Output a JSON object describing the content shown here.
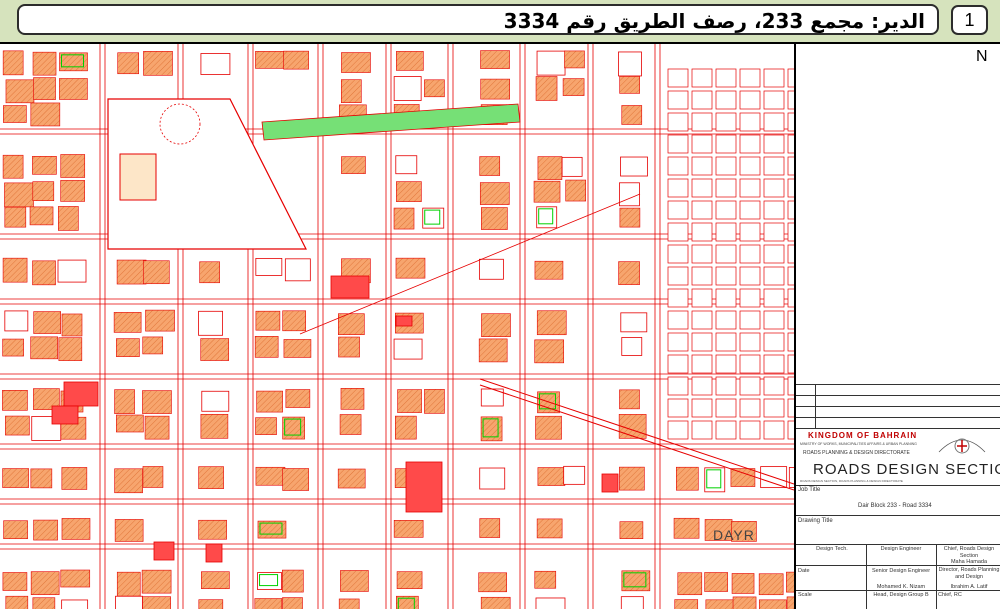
{
  "header": {
    "slide_number": "1",
    "title": "الدير: مجمع 233، رصف الطريق رقم 3334"
  },
  "map": {
    "place_label": "DAYR",
    "colors": {
      "parcel_fill": "#f7a56e",
      "road": "#e60000",
      "green": "#00d000",
      "highlight": "#ff4a4a",
      "park": "#76e076"
    }
  },
  "title_block": {
    "north_symbol": "N",
    "kingdom": "KINGDOM OF BAHRAIN",
    "ministry": "MINISTRY OF WORKS, MUNICIPALITIES AFFAIRS & URBAN PLANNING",
    "directorate": "ROADS PLANNING & DESIGN DIRECTORATE",
    "section": "ROADS DESIGN SECTION",
    "section_sub": "ROADS DESIGN SECTION, ROADS PLANNING & DESIGN DIRECTORATE",
    "job_title_label": "Job Title",
    "job_title_value": "Dair Block 233 - Road 3334",
    "drawing_title_label": "Drawing Title",
    "signatures": {
      "design_tech": "Design Tech.",
      "design_engineer": "Design Engineer",
      "chief": "Chief, Roads Design Section",
      "chief_name": "Maha Hamada",
      "date_label": "Date",
      "senior_engineer": "Senior Design Engineer",
      "director": "Director, Roads Planning and Design",
      "engineer_name": "Mohamed K. Nizam",
      "director_name": "Ibrahim A. Latif",
      "scale_label": "Scale",
      "head": "Head, Design Group B",
      "chief_rc": "Chief, RC"
    }
  }
}
